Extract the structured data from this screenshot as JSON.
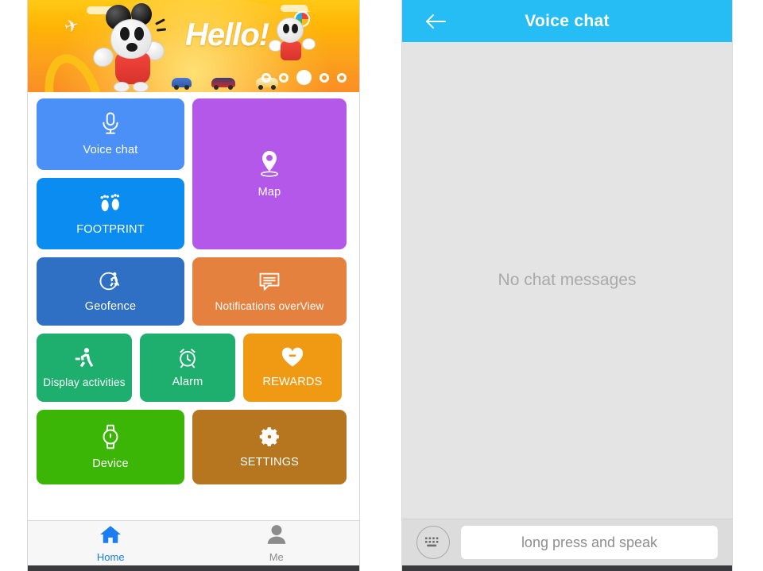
{
  "left_phone": {
    "banner": {
      "greeting": "Hello!",
      "pager_dots": 5,
      "active_dot_index": 2
    },
    "tiles": [
      {
        "label": "Voice chat",
        "icon": "microphone-icon",
        "color": "#4b90f7"
      },
      {
        "label": "Map",
        "icon": "map-pin-icon",
        "color": "#b358e9"
      },
      {
        "label": "FOOTPRINT",
        "icon": "footprints-icon",
        "color": "#0b8cf0"
      },
      {
        "label": "Geofence",
        "icon": "geofence-runner-icon",
        "color": "#2f6fc4"
      },
      {
        "label": "Notifications overView",
        "icon": "speech-bubble-lines-icon",
        "color": "#e5813f"
      },
      {
        "label": "Display activities",
        "icon": "running-person-icon",
        "color": "#1eae6e"
      },
      {
        "label": "Alarm",
        "icon": "alarm-clock-icon",
        "color": "#1eae6e"
      },
      {
        "label": "REWARDS",
        "icon": "heart-icon",
        "color": "#f09a14"
      },
      {
        "label": "Device",
        "icon": "smartwatch-icon",
        "color": "#3cb606"
      },
      {
        "label": "SETTINGS",
        "icon": "gear-icon",
        "color": "#b5761f"
      }
    ],
    "tabbar": {
      "tabs": [
        {
          "label": "Home",
          "icon": "home-icon",
          "active": true,
          "color": "#1a7ef0"
        },
        {
          "label": "Me",
          "icon": "person-icon",
          "active": false,
          "color": "#8c8c8c"
        }
      ]
    }
  },
  "right_phone": {
    "header": {
      "title": "Voice chat",
      "back_icon": "back-arrow-icon",
      "color": "#25bdf3"
    },
    "body": {
      "empty_state": "No chat messages"
    },
    "input_bar": {
      "keyboard_icon": "keyboard-icon",
      "speak_button_label": "long press and speak"
    }
  }
}
